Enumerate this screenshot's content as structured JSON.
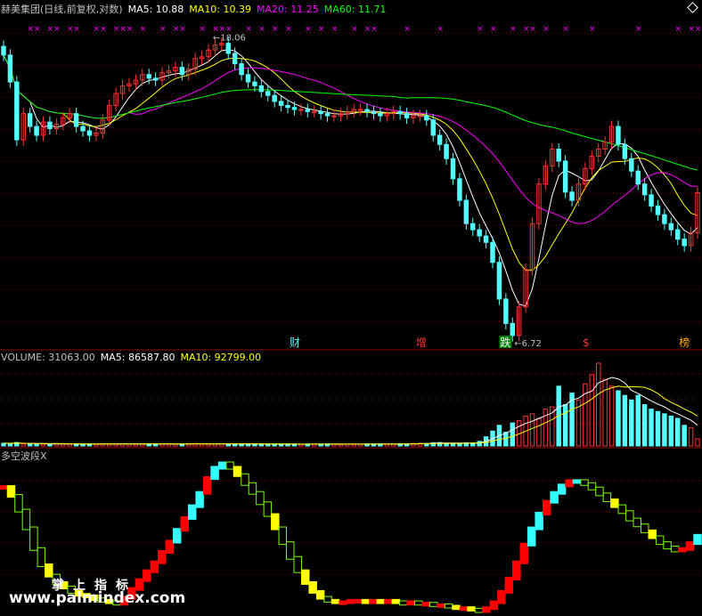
{
  "colors": {
    "bg": "#000000",
    "grid": "#8b0000",
    "up": "#ff3232",
    "down": "#54ffff",
    "ma5": "#ffffff",
    "ma10": "#ffff00",
    "ma20": "#ff00ff",
    "ma60": "#00ff00",
    "osc_hollow": "#7cfc00",
    "osc_solid_yellow": "#ffff00",
    "osc_red": "#ff0000",
    "osc_cyan": "#33ffff"
  },
  "price_panel": {
    "title": "赫美集团(日线,前复权,对数)",
    "ma5": "MA5: 10.88",
    "ma10": "MA10: 10.39",
    "ma20": "MA20: 11.25",
    "ma60": "MA60: 11.71",
    "high_label": "18.06",
    "low_label": "6.72",
    "markers": [
      {
        "text": "财",
        "color": "#54ffff"
      },
      {
        "text": "增",
        "color": "#ff3232"
      },
      {
        "text": "跌",
        "color": "#ffffff",
        "bg": "#008000"
      },
      {
        "text": "$",
        "color": "#ff3232"
      },
      {
        "text": "榜",
        "color": "#ffaa00"
      }
    ],
    "top_mark": "×"
  },
  "volume_panel": {
    "vol": "VOLUME: 31063.00",
    "ma5": "MA5: 86587.80",
    "ma10": "MA10: 92799.00"
  },
  "osc_panel": {
    "title": "多空波段X"
  },
  "watermark": {
    "cn": "掌上指标",
    "url": "www.palmindex.com"
  },
  "chart_data": {
    "type": "candlestick",
    "ylim": [
      6.5,
      19.5
    ],
    "closes": [
      17.3,
      15.8,
      13.0,
      14.2,
      13.6,
      13.2,
      13.8,
      13.5,
      13.7,
      14.0,
      14.2,
      13.6,
      13.4,
      13.2,
      13.3,
      13.9,
      14.6,
      15.2,
      15.6,
      15.7,
      15.9,
      16.2,
      16.0,
      15.9,
      16.3,
      16.4,
      16.6,
      16.2,
      16.5,
      17.1,
      17.2,
      17.6,
      17.9,
      18.0,
      17.4,
      16.8,
      16.2,
      15.8,
      15.6,
      15.3,
      15.1,
      14.8,
      14.6,
      14.5,
      14.4,
      14.4,
      14.3,
      14.3,
      14.2,
      14.1,
      14.1,
      14.2,
      14.3,
      14.4,
      14.4,
      14.3,
      14.2,
      14.1,
      14.2,
      14.3,
      14.2,
      14.0,
      14.1,
      14.1,
      13.9,
      13.2,
      12.8,
      12.2,
      11.4,
      10.6,
      9.8,
      9.6,
      9.4,
      9.2,
      8.6,
      7.6,
      7.0,
      6.72,
      7.4,
      8.4,
      9.8,
      11.2,
      11.9,
      12.6,
      12.1,
      10.9,
      10.6,
      11.2,
      11.8,
      12.3,
      12.6,
      12.9,
      13.6,
      12.8,
      12.2,
      11.7,
      11.2,
      10.8,
      10.4,
      10.1,
      9.8,
      9.6,
      9.3,
      9.1,
      9.5,
      10.88
    ],
    "volume": [
      12000,
      11000,
      15000,
      9000,
      10000,
      9000,
      8000,
      9000,
      10000,
      9000,
      8000,
      9000,
      8000,
      9000,
      8000,
      9000,
      10000,
      9000,
      10000,
      9000,
      8000,
      9000,
      10000,
      9000,
      8000,
      9000,
      8000,
      9000,
      10000,
      11000,
      9000,
      8000,
      9000,
      10000,
      9000,
      8000,
      9000,
      10000,
      8000,
      9000,
      8000,
      7000,
      8000,
      9000,
      8000,
      7000,
      8000,
      9000,
      8000,
      9000,
      8000,
      7000,
      8000,
      9000,
      8000,
      9000,
      8000,
      9000,
      8000,
      9000,
      10000,
      9000,
      11000,
      12000,
      11000,
      14000,
      15000,
      12000,
      9000,
      11000,
      14000,
      13000,
      20000,
      40000,
      65000,
      90000,
      60000,
      100000,
      110000,
      130000,
      140000,
      120000,
      160000,
      170000,
      260000,
      180000,
      230000,
      200000,
      270000,
      310000,
      360000,
      290000,
      260000,
      240000,
      220000,
      200000,
      220000,
      180000,
      160000,
      150000,
      140000,
      130000,
      120000,
      90000,
      80000,
      31063
    ],
    "oscillator": [
      0.84,
      0.78,
      0.68,
      0.56,
      0.42,
      0.31,
      0.24,
      0.19,
      0.16,
      0.13,
      0.11,
      0.1,
      0.08,
      0.07,
      0.06,
      0.05,
      0.09,
      0.15,
      0.21,
      0.27,
      0.33,
      0.4,
      0.47,
      0.55,
      0.63,
      0.71,
      0.8,
      0.9,
      0.97,
      1.0,
      0.97,
      0.92,
      0.86,
      0.8,
      0.73,
      0.65,
      0.56,
      0.46,
      0.36,
      0.27,
      0.19,
      0.13,
      0.09,
      0.07,
      0.06,
      0.06,
      0.07,
      0.07,
      0.06,
      0.07,
      0.06,
      0.07,
      0.06,
      0.05,
      0.06,
      0.05,
      0.05,
      0.04,
      0.04,
      0.03,
      0.02,
      0.02,
      0.01,
      0.0,
      0.02,
      0.06,
      0.13,
      0.22,
      0.33,
      0.45,
      0.56,
      0.66,
      0.74,
      0.8,
      0.85,
      0.88,
      0.88,
      0.86,
      0.83,
      0.79,
      0.75,
      0.71,
      0.67,
      0.62,
      0.58,
      0.54,
      0.5,
      0.46,
      0.43,
      0.41,
      0.42,
      0.46,
      0.51
    ]
  }
}
